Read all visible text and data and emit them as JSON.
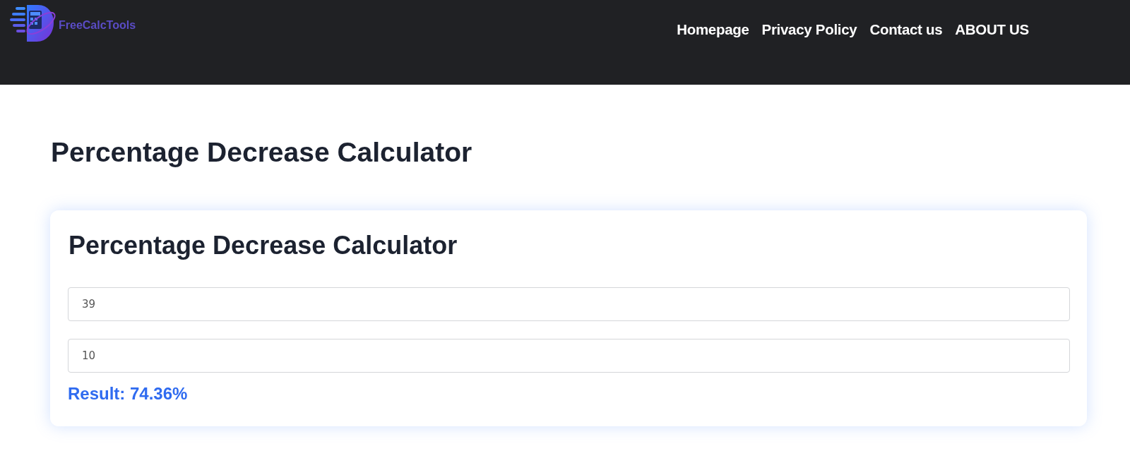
{
  "header": {
    "logo_text": "FreeCalcTools",
    "nav_links": [
      {
        "label": "Homepage"
      },
      {
        "label": "Privacy Policy"
      },
      {
        "label": "Contact us"
      },
      {
        "label": "ABOUT US"
      }
    ]
  },
  "page_title": "Percentage Decrease Calculator",
  "calculator": {
    "title": "Percentage Decrease Calculator",
    "fields": [
      {
        "value": "39"
      },
      {
        "value": "10"
      }
    ],
    "result": "Result: 74.36%"
  }
}
